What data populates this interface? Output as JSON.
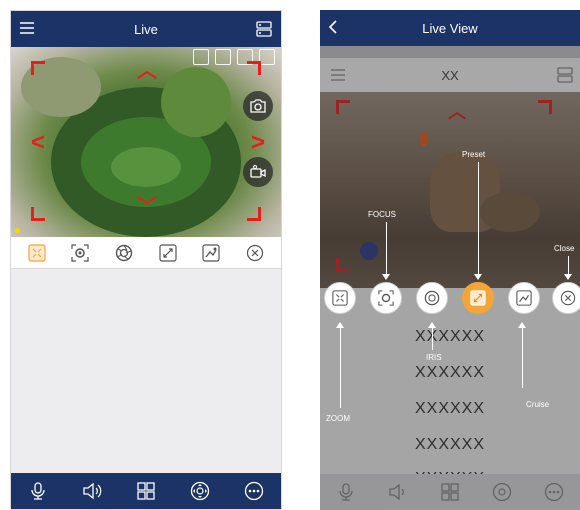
{
  "left_screen": {
    "title": "Live",
    "ptz_arrows": {
      "up": "︿",
      "down": "﹀",
      "left": "<",
      "right": ">"
    },
    "video_icons": [
      "grid-icon",
      "list-icon",
      "window-icon",
      "fullscreen-icon"
    ],
    "overlay_buttons": [
      "snapshot-icon",
      "record-icon"
    ],
    "control_bar": [
      "zoom-icon",
      "focus-icon",
      "iris-icon",
      "preset-icon",
      "cruise-icon",
      "close-icon"
    ],
    "tab_bar": [
      "talk-icon",
      "audio-icon",
      "multi-view-icon",
      "ptz-icon",
      "more-icon"
    ]
  },
  "right_screen": {
    "title": "Live View",
    "inner_title": "XX",
    "list_items": [
      "XXXXXX",
      "XXXXXX",
      "XXXXXX",
      "XXXXXX",
      "XXXXXX"
    ],
    "annotations": {
      "zoom": "ZOOM",
      "focus": "FOCUS",
      "iris": "IRIS",
      "preset": "Preset",
      "cruise": "Cruise",
      "close": "Close"
    }
  },
  "colors": {
    "nav": "#1b3366",
    "ptz_red": "#e51f1f",
    "preset_orange": "#f3a537"
  }
}
